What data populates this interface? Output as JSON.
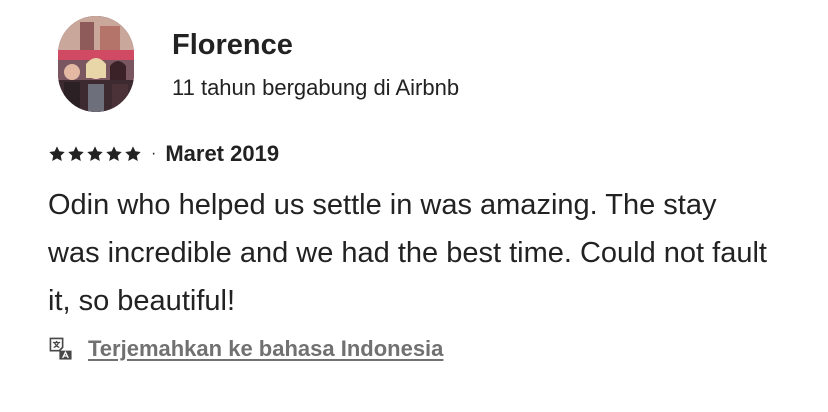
{
  "review": {
    "reviewer": {
      "name": "Florence",
      "member_since": "11 tahun bergabung di Airbnb",
      "avatar_icon": "reviewer-photo"
    },
    "rating": {
      "stars": 5,
      "max": 5,
      "separator": "·",
      "date": "Maret 2019"
    },
    "text": "Odin who helped us settle in was amazing. The stay was incredible and we had the best time. Could not fault it, so beautiful!",
    "translate": {
      "icon": "translate-icon",
      "label": "Terjemahkan ke bahasa Indonesia"
    }
  },
  "colors": {
    "text_primary": "#222222",
    "text_secondary": "#717171",
    "background": "#ffffff"
  }
}
